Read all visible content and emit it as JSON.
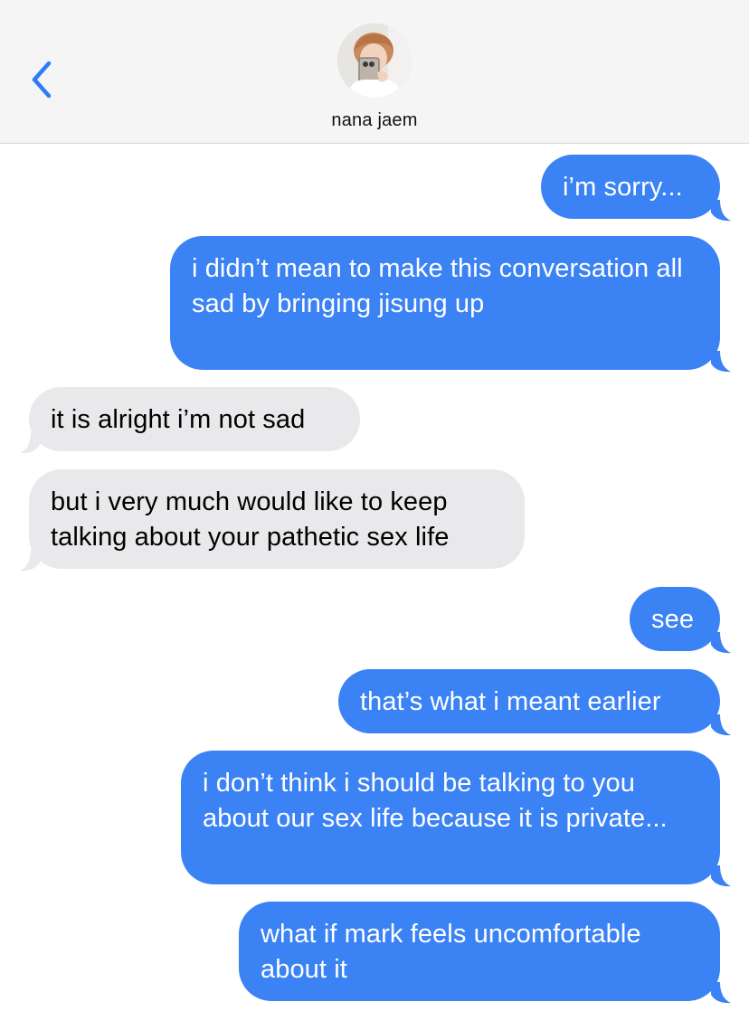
{
  "header": {
    "contact_name": "nana jaem",
    "back_icon": "chevron-left-icon",
    "accent_color": "#2f7cf6"
  },
  "colors": {
    "sent_bubble": "#3b82f4",
    "received_bubble": "#e9e9eb"
  },
  "messages": [
    {
      "sender": "me",
      "text": "i’m sorry..."
    },
    {
      "sender": "me",
      "text": "i didn’t mean to make this conversation all sad by bringing jisung up"
    },
    {
      "sender": "them",
      "text": "it is alright i’m not sad"
    },
    {
      "sender": "them",
      "text": "but i very much would like to keep talking about your pathetic sex life"
    },
    {
      "sender": "me",
      "text": "see"
    },
    {
      "sender": "me",
      "text": "that’s what i meant earlier"
    },
    {
      "sender": "me",
      "text": "i don’t think i should be talking to you about our sex life because it is private..."
    },
    {
      "sender": "me",
      "text": "what if mark feels uncomfortable about it"
    }
  ]
}
